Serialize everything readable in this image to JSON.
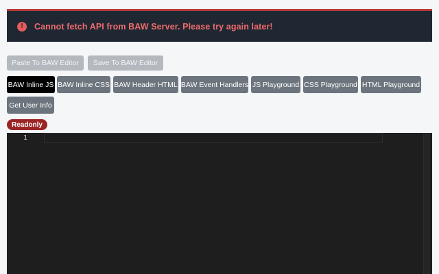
{
  "alert": {
    "message": "Cannot fetch API from BAW Server. Please try again later!",
    "icon": "info-circle-icon",
    "text_color": "#f06b6b",
    "bg_color": "#1f2733"
  },
  "actions": {
    "paste_label": "Paste To BAW Editor",
    "save_label": "Save To BAW Editor"
  },
  "tabs": [
    {
      "label": "BAW Inline JS",
      "active": true
    },
    {
      "label": "BAW Inline CSS",
      "active": false
    },
    {
      "label": "BAW Header HTML",
      "active": false
    },
    {
      "label": "BAW Event Handlers",
      "active": false
    },
    {
      "label": "JS Playground",
      "active": false
    },
    {
      "label": "CSS Playground",
      "active": false
    },
    {
      "label": "HTML Playground",
      "active": false
    },
    {
      "label": "Get User Info",
      "active": false
    }
  ],
  "badge": {
    "label": "Readonly",
    "color": "#9b2424"
  },
  "editor": {
    "line_numbers": [
      "1"
    ],
    "content": ""
  }
}
